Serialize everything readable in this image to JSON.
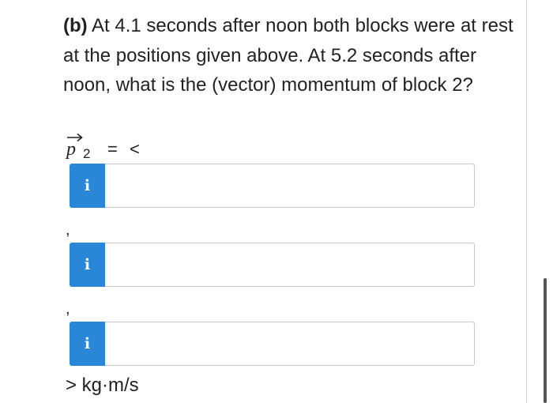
{
  "question": {
    "part_label": "(b)",
    "text": "At 4.1 seconds after noon both blocks were at rest at the positions given above. At 5.2 seconds after noon, what is the (vector) momentum of block 2?"
  },
  "vector_label": {
    "symbol": "p",
    "subscript": "2",
    "equals": "=",
    "open_bracket": "<"
  },
  "info_button_label": "i",
  "separator": ",",
  "fields": [
    {
      "value": "",
      "placeholder": ""
    },
    {
      "value": "",
      "placeholder": ""
    },
    {
      "value": "",
      "placeholder": ""
    }
  ],
  "closing": "> kg·m/s",
  "colors": {
    "info_button": "#2a86d6",
    "field_border": "#c9c9c9",
    "text": "#222222"
  }
}
